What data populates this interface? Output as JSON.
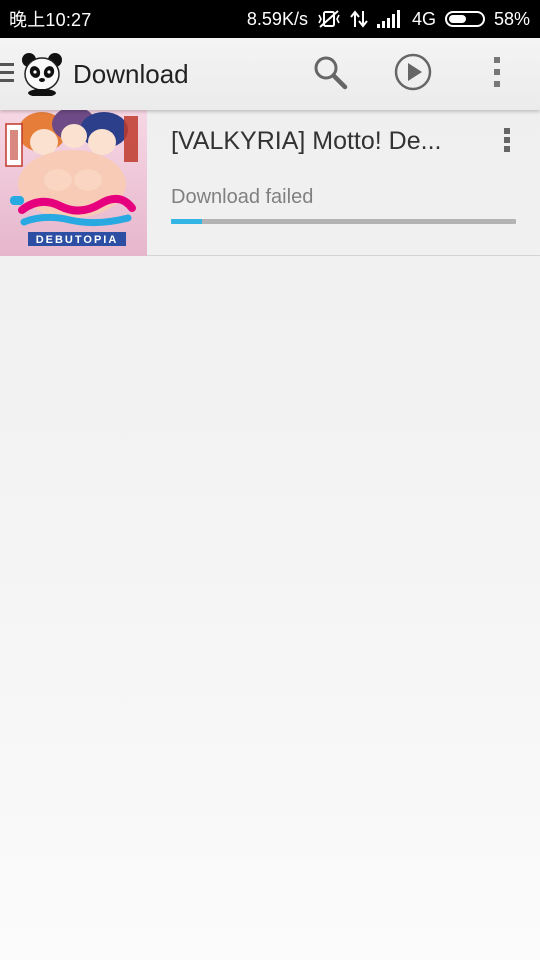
{
  "status_bar": {
    "time": "晚上10:27",
    "net_speed": "8.59K/s",
    "network": "4G",
    "battery_percent": "58%",
    "battery_level": 0.58,
    "icons": [
      "vibrate-off-icon",
      "data-transfer-icon",
      "signal-icon",
      "battery-icon"
    ]
  },
  "action_bar": {
    "title": "Download",
    "icons": [
      "drawer-icon",
      "panda-logo-icon",
      "search-icon",
      "play-circle-icon",
      "overflow-menu-icon"
    ]
  },
  "downloads": [
    {
      "title": "[VALKYRIA] Motto! De...",
      "status": "Download failed",
      "progress": 0.09,
      "cover_text": "DEBUTOPIA"
    }
  ],
  "colors": {
    "progress_fill": "#33b5e5",
    "progress_track": "#b3b3b3",
    "status_bar_bg": "#000000"
  }
}
